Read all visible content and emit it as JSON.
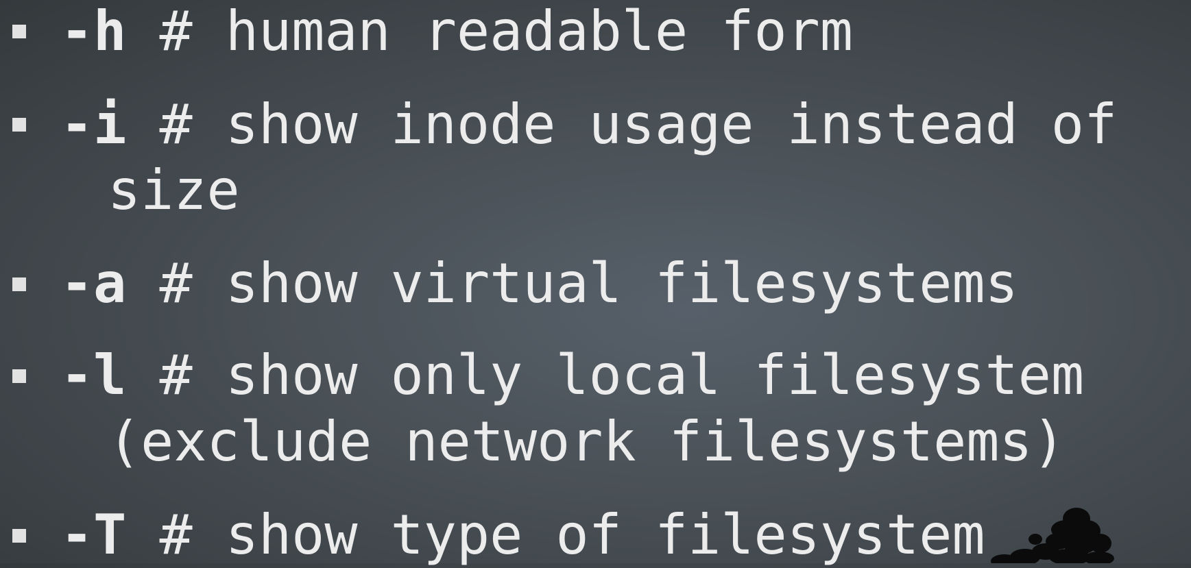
{
  "options": [
    {
      "flag": "-h",
      "description": " # human readable form",
      "continuation": ""
    },
    {
      "flag": "-i",
      "description": " # show inode usage instead of",
      "continuation": "size"
    },
    {
      "flag": "-a",
      "description": " # show virtual filesystems",
      "continuation": ""
    },
    {
      "flag": "-l",
      "description": " # show only local filesystem",
      "continuation": "(exclude network filesystems)"
    },
    {
      "flag": "-T",
      "description": " # show type of filesystem",
      "continuation": ""
    }
  ],
  "colors": {
    "text": "#ececec",
    "background_center": "#57606a",
    "background_edge": "#34393c",
    "bullet": "#e2e2e2"
  },
  "icons": {
    "bullet": "square-bullet-icon",
    "decoration": "tree-silhouette-icon"
  }
}
